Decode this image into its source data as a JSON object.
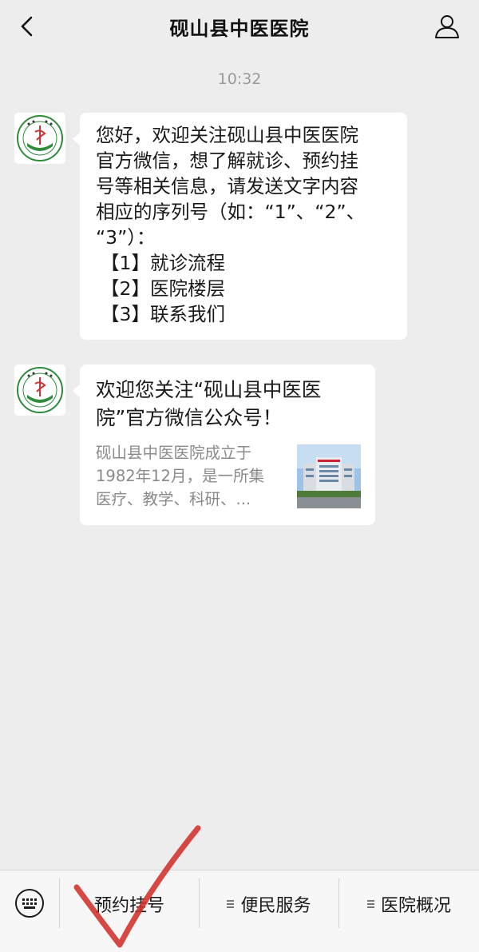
{
  "header": {
    "title": "砚山县中医医院",
    "back_icon": "chevron-left-icon",
    "profile_icon": "person-icon"
  },
  "timestamp": "10:32",
  "messages": {
    "welcome": {
      "lines": [
        "您好，欢迎关注砚山县中医医院",
        "官方微信，想了解就诊、预约挂",
        "号等相关信息，请发送文字内容",
        "相应的序列号（如：“1”、“2”、",
        "“3”）："
      ],
      "menu": [
        "【1】就诊流程",
        "【2】医院楼层",
        "【3】联系我们"
      ]
    },
    "article": {
      "title_lines": [
        "欢迎您关注“砚山县中医医",
        "院”官方微信公众号！"
      ],
      "desc_lines": [
        "砚山县中医医院成立于",
        "1982年12月，是一所集",
        "医疗、教学、科研、..."
      ]
    }
  },
  "bottom_menu": {
    "keyboard_icon": "keyboard-icon",
    "items": [
      "预约挂号",
      "便民服务",
      "医院概况"
    ]
  },
  "colors": {
    "background": "#ededed",
    "bubble": "#ffffff",
    "checkmark": "#d0302b"
  }
}
